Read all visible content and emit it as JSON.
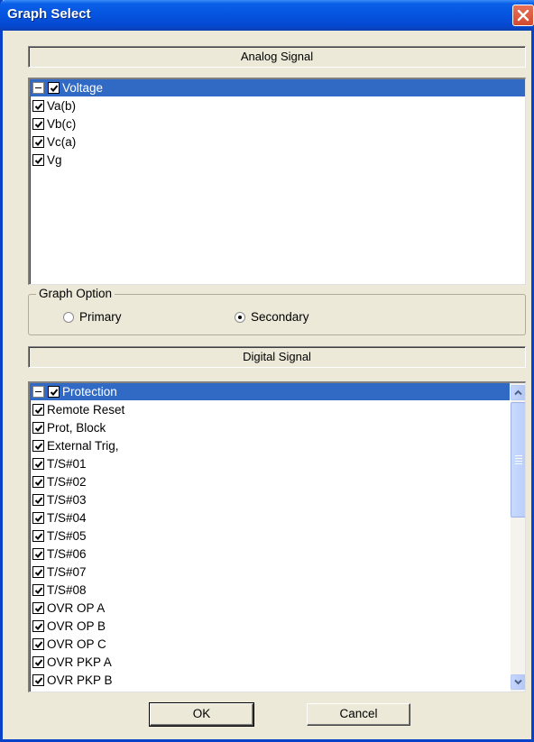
{
  "window": {
    "title": "Graph Select"
  },
  "analog": {
    "header": "Analog Signal",
    "root": {
      "label": "Voltage",
      "checked": true,
      "expanded": true
    },
    "items": [
      {
        "label": "Va(b)",
        "checked": true
      },
      {
        "label": "Vb(c)",
        "checked": true
      },
      {
        "label": "Vc(a)",
        "checked": true
      },
      {
        "label": "Vg",
        "checked": true
      }
    ]
  },
  "graph_option": {
    "legend": "Graph Option",
    "options": [
      {
        "label": "Primary",
        "selected": false
      },
      {
        "label": "Secondary",
        "selected": true
      }
    ]
  },
  "digital": {
    "header": "Digital Signal",
    "root": {
      "label": "Protection",
      "checked": true,
      "expanded": true
    },
    "items": [
      {
        "label": "Remote Reset",
        "checked": true
      },
      {
        "label": "Prot, Block",
        "checked": true
      },
      {
        "label": "External Trig,",
        "checked": true
      },
      {
        "label": "T/S#01",
        "checked": true
      },
      {
        "label": "T/S#02",
        "checked": true
      },
      {
        "label": "T/S#03",
        "checked": true
      },
      {
        "label": "T/S#04",
        "checked": true
      },
      {
        "label": "T/S#05",
        "checked": true
      },
      {
        "label": "T/S#06",
        "checked": true
      },
      {
        "label": "T/S#07",
        "checked": true
      },
      {
        "label": "T/S#08",
        "checked": true
      },
      {
        "label": "OVR OP A",
        "checked": true
      },
      {
        "label": "OVR OP B",
        "checked": true
      },
      {
        "label": "OVR OP C",
        "checked": true
      },
      {
        "label": "OVR PKP A",
        "checked": true
      },
      {
        "label": "OVR PKP B",
        "checked": true
      }
    ]
  },
  "buttons": {
    "ok": "OK",
    "cancel": "Cancel"
  },
  "icons": {
    "close": "close-icon",
    "checkbox": "checkmark-icon",
    "collapse": "minus-box-icon",
    "scroll_up": "chevron-up-icon",
    "scroll_down": "chevron-down-icon"
  },
  "colors": {
    "title_bar": "#0553df",
    "selection": "#316ac5",
    "dialog_bg": "#ece9d8",
    "close_button": "#d44a2e"
  }
}
